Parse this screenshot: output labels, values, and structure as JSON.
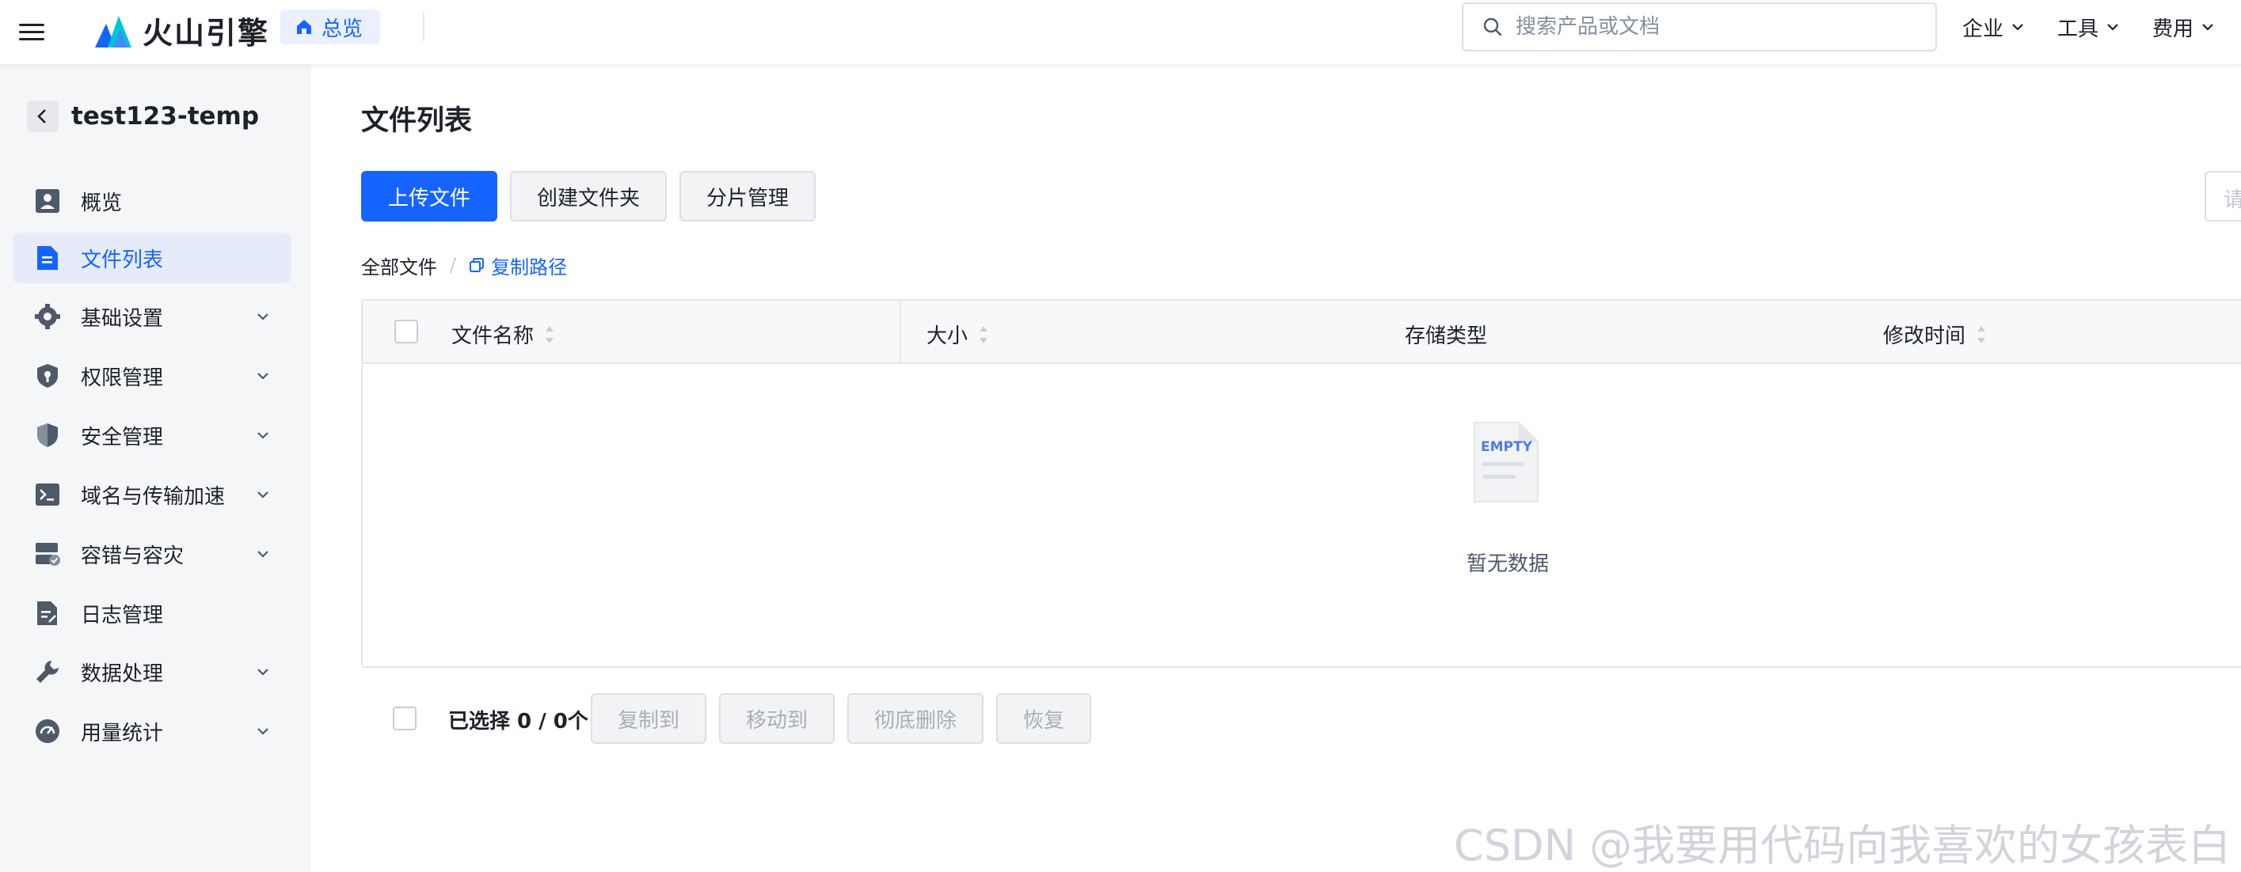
{
  "header": {
    "logo_text": "火山引擎",
    "home_label": "总览",
    "search_placeholder": "搜索产品或文档",
    "menus": [
      "企业",
      "工具",
      "费用"
    ]
  },
  "sidebar": {
    "bucket_name": "test123-temp",
    "items": [
      {
        "label": "概览",
        "icon": "overview-icon",
        "expandable": false,
        "active": false
      },
      {
        "label": "文件列表",
        "icon": "file-icon",
        "expandable": false,
        "active": true
      },
      {
        "label": "基础设置",
        "icon": "gear-icon",
        "expandable": true,
        "active": false
      },
      {
        "label": "权限管理",
        "icon": "shield-key-icon",
        "expandable": true,
        "active": false
      },
      {
        "label": "安全管理",
        "icon": "shield-icon",
        "expandable": true,
        "active": false
      },
      {
        "label": "域名与传输加速",
        "icon": "terminal-icon",
        "expandable": true,
        "active": false
      },
      {
        "label": "容错与容灾",
        "icon": "server-icon",
        "expandable": true,
        "active": false
      },
      {
        "label": "日志管理",
        "icon": "log-icon",
        "expandable": false,
        "active": false
      },
      {
        "label": "数据处理",
        "icon": "wrench-icon",
        "expandable": true,
        "active": false
      },
      {
        "label": "用量统计",
        "icon": "gauge-icon",
        "expandable": true,
        "active": false
      }
    ]
  },
  "main": {
    "title": "文件列表",
    "toolbar": {
      "upload": "上传文件",
      "create_folder": "创建文件夹",
      "multipart": "分片管理",
      "right_input_placeholder": "请"
    },
    "breadcrumb": {
      "all": "全部文件",
      "separator": "/",
      "copy_path": "复制路径"
    },
    "table": {
      "columns": [
        "文件名称",
        "大小",
        "存储类型",
        "修改时间"
      ],
      "rows": [],
      "empty_text": "暂无数据",
      "empty_illustration_text": "EMPTY"
    },
    "footer": {
      "selected": "已选择 0 / 0个",
      "actions": [
        "复制到",
        "移动到",
        "彻底删除",
        "恢复"
      ]
    }
  },
  "watermark": "CSDN @我要用代码向我喜欢的女孩表白",
  "colors": {
    "primary": "#1664ff",
    "sidebar_bg": "#f5f6f8",
    "active_bg": "#e5ebf9"
  }
}
